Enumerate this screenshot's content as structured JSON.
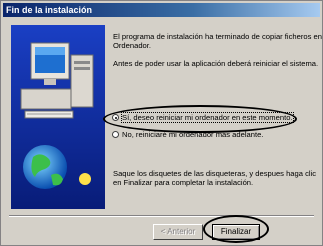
{
  "window": {
    "title": "Fin de la instalación"
  },
  "message": {
    "line1": "El programa de instalación ha terminado de copiar ficheros en su",
    "line2": "Ordenador.",
    "line3": "Antes de poder usar la aplicación deberá reiniciar el sistema.",
    "footer1": "Saque los disquetes de las disqueteras, y despues haga clic",
    "footer2": "en Finalizar para completar la instalación."
  },
  "options": {
    "restart_now": "Sí, deseo reiniciar mi ordenador en este momento.",
    "restart_later": "No, reiniciaré mi ordenador más adelante.",
    "selected": "restart_now"
  },
  "buttons": {
    "back": "< Anterior",
    "finish": "Finalizar"
  }
}
